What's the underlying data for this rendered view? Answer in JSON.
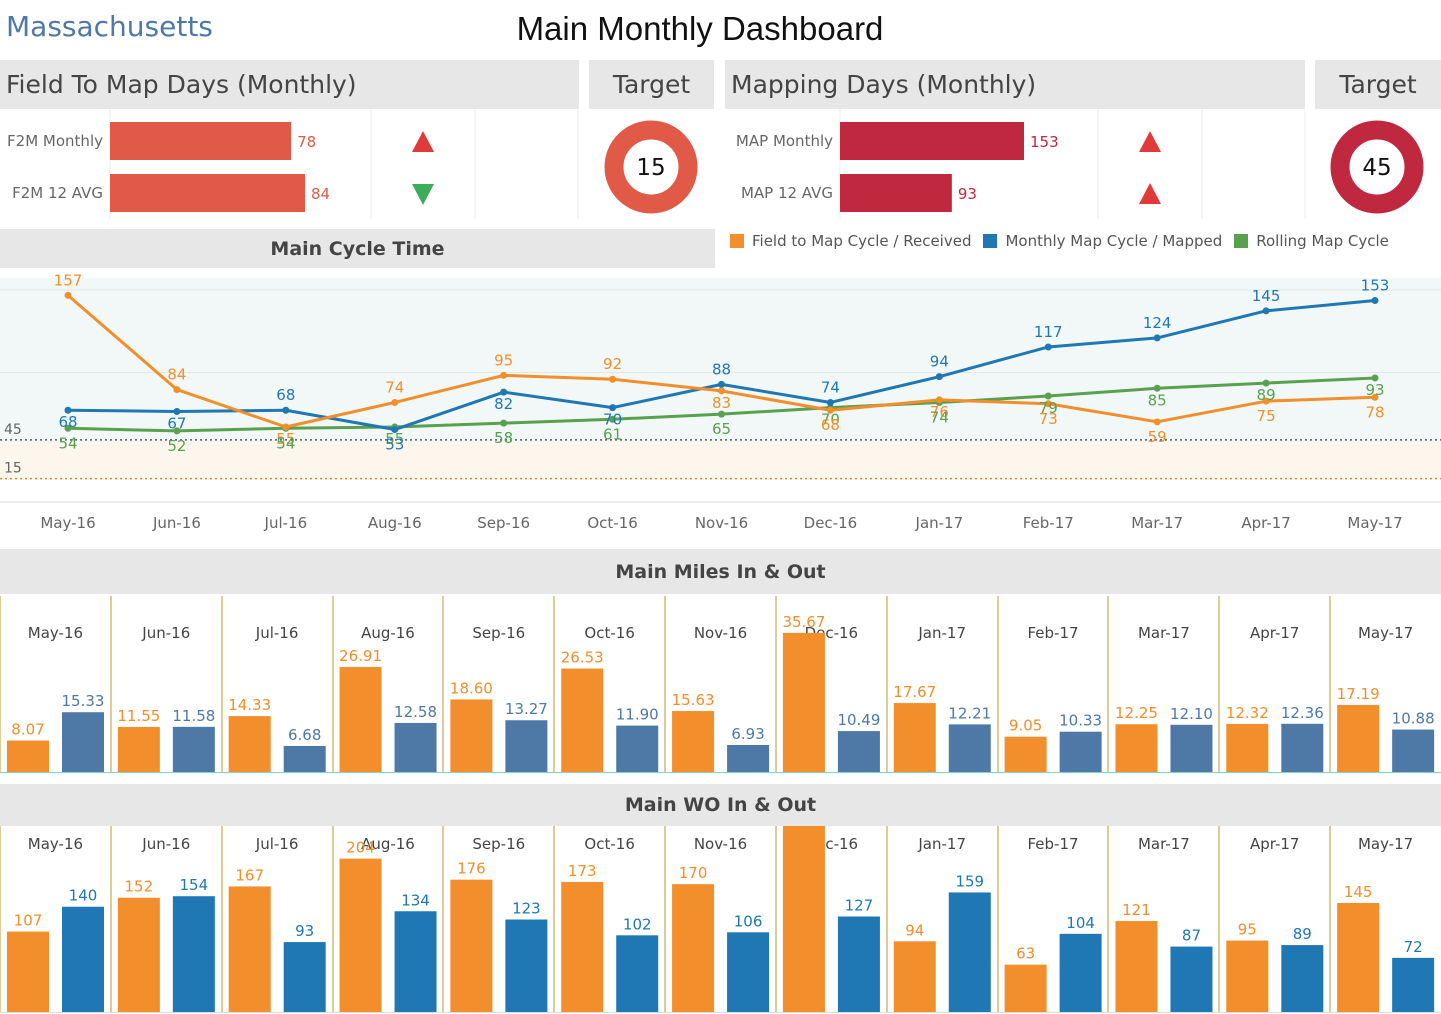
{
  "header": {
    "state": "Massachusetts",
    "title": "Main Monthly Dashboard"
  },
  "colors": {
    "f2m": "#e15a47",
    "map": "#c0283f",
    "orange": "#f28e2b",
    "blue": "#1f77b4",
    "green": "#59a14f",
    "up": "#e03a3a",
    "down": "#3cae5a",
    "steel": "#4e79a7",
    "panel": "#e7e7e7",
    "gold": "#b99b30"
  },
  "kpi_left": {
    "title": "Field To Map Days (Monthly)",
    "target_title": "Target",
    "target_value": "15",
    "rows": [
      {
        "label": "F2M Monthly",
        "value": 78,
        "value_text": "78",
        "trend": "up",
        "icon": "triangle-up-icon"
      },
      {
        "label": "F2M 12 AVG",
        "value": 84,
        "value_text": "84",
        "trend": "down",
        "icon": "triangle-down-icon"
      }
    ]
  },
  "kpi_right": {
    "title": "Mapping Days (Monthly)",
    "target_title": "Target",
    "target_value": "45",
    "rows": [
      {
        "label": "MAP Monthly",
        "value": 153,
        "value_text": "153",
        "trend": "up",
        "icon": "triangle-up-icon"
      },
      {
        "label": "MAP 12 AVG",
        "value": 93,
        "value_text": "93",
        "trend": "up",
        "icon": "triangle-up-icon"
      }
    ]
  },
  "legend": [
    {
      "name": "Field to Map Cycle / Received",
      "color": "#f28e2b"
    },
    {
      "name": "Monthly Map Cycle / Mapped",
      "color": "#1f77b4"
    },
    {
      "name": "Rolling Map Cycle",
      "color": "#59a14f"
    }
  ],
  "chart_data": [
    {
      "type": "line",
      "title": "Main Cycle Time",
      "categories": [
        "May-16",
        "Jun-16",
        "Jul-16",
        "Aug-16",
        "Sep-16",
        "Oct-16",
        "Nov-16",
        "Dec-16",
        "Jan-17",
        "Feb-17",
        "Mar-17",
        "Apr-17",
        "May-17"
      ],
      "ylim": [
        0,
        165
      ],
      "reference_lines": [
        {
          "value": 45,
          "label": "45"
        },
        {
          "value": 15,
          "label": "15"
        }
      ],
      "series": [
        {
          "name": "Field to Map Cycle / Received",
          "color": "#f28e2b",
          "values": [
            157,
            84,
            55,
            74,
            95,
            92,
            83,
            68,
            76,
            73,
            59,
            75,
            78
          ]
        },
        {
          "name": "Monthly Map Cycle / Mapped",
          "color": "#1f77b4",
          "values": [
            68,
            67,
            68,
            53,
            82,
            70,
            88,
            74,
            94,
            117,
            124,
            145,
            153
          ]
        },
        {
          "name": "Rolling Map Cycle",
          "color": "#59a14f",
          "values": [
            54,
            52,
            54,
            55,
            58,
            61,
            65,
            70,
            74,
            79,
            85,
            89,
            93
          ]
        }
      ]
    },
    {
      "type": "bar",
      "title": "Main Miles In & Out",
      "categories": [
        "May-16",
        "Jun-16",
        "Jul-16",
        "Aug-16",
        "Sep-16",
        "Oct-16",
        "Nov-16",
        "Dec-16",
        "Jan-17",
        "Feb-17",
        "Mar-17",
        "Apr-17",
        "May-17"
      ],
      "ylim": [
        0,
        40
      ],
      "series": [
        {
          "color": "#f28e2b",
          "values": [
            8.07,
            11.55,
            14.33,
            26.91,
            18.6,
            26.53,
            15.63,
            35.67,
            17.67,
            9.05,
            12.25,
            12.32,
            17.19
          ],
          "labels": [
            "8.07",
            "11.55",
            "14.33",
            "26.91",
            "18.60",
            "26.53",
            "15.63",
            "35.67",
            "17.67",
            "9.05",
            "12.25",
            "12.32",
            "17.19"
          ]
        },
        {
          "color": "#4e79a7",
          "values": [
            15.33,
            11.58,
            6.68,
            12.58,
            13.27,
            11.9,
            6.93,
            10.49,
            12.21,
            10.33,
            12.1,
            12.36,
            10.88
          ],
          "labels": [
            "15.33",
            "11.58",
            "6.68",
            "12.58",
            "13.27",
            "11.90",
            "6.93",
            "10.49",
            "12.21",
            "10.33",
            "12.10",
            "12.36",
            "10.88"
          ]
        }
      ]
    },
    {
      "type": "bar",
      "title": "Main WO In & Out",
      "categories": [
        "May-16",
        "Jun-16",
        "Jul-16",
        "Aug-16",
        "Sep-16",
        "Oct-16",
        "Nov-16",
        "Dec-16",
        "Jan-17",
        "Feb-17",
        "Mar-17",
        "Apr-17",
        "May-17"
      ],
      "ylim": [
        0,
        270
      ],
      "series": [
        {
          "color": "#f28e2b",
          "values": [
            107,
            152,
            167,
            204,
            176,
            173,
            170,
            250,
            94,
            63,
            121,
            95,
            145
          ],
          "labels": [
            "107",
            "152",
            "167",
            "204",
            "176",
            "173",
            "170",
            "250",
            "94",
            "63",
            "121",
            "95",
            "145"
          ]
        },
        {
          "color": "#1f77b4",
          "values": [
            140,
            154,
            93,
            134,
            123,
            102,
            106,
            127,
            159,
            104,
            87,
            89,
            72
          ],
          "labels": [
            "140",
            "154",
            "93",
            "134",
            "123",
            "102",
            "106",
            "127",
            "159",
            "104",
            "87",
            "89",
            "72"
          ]
        }
      ]
    }
  ]
}
